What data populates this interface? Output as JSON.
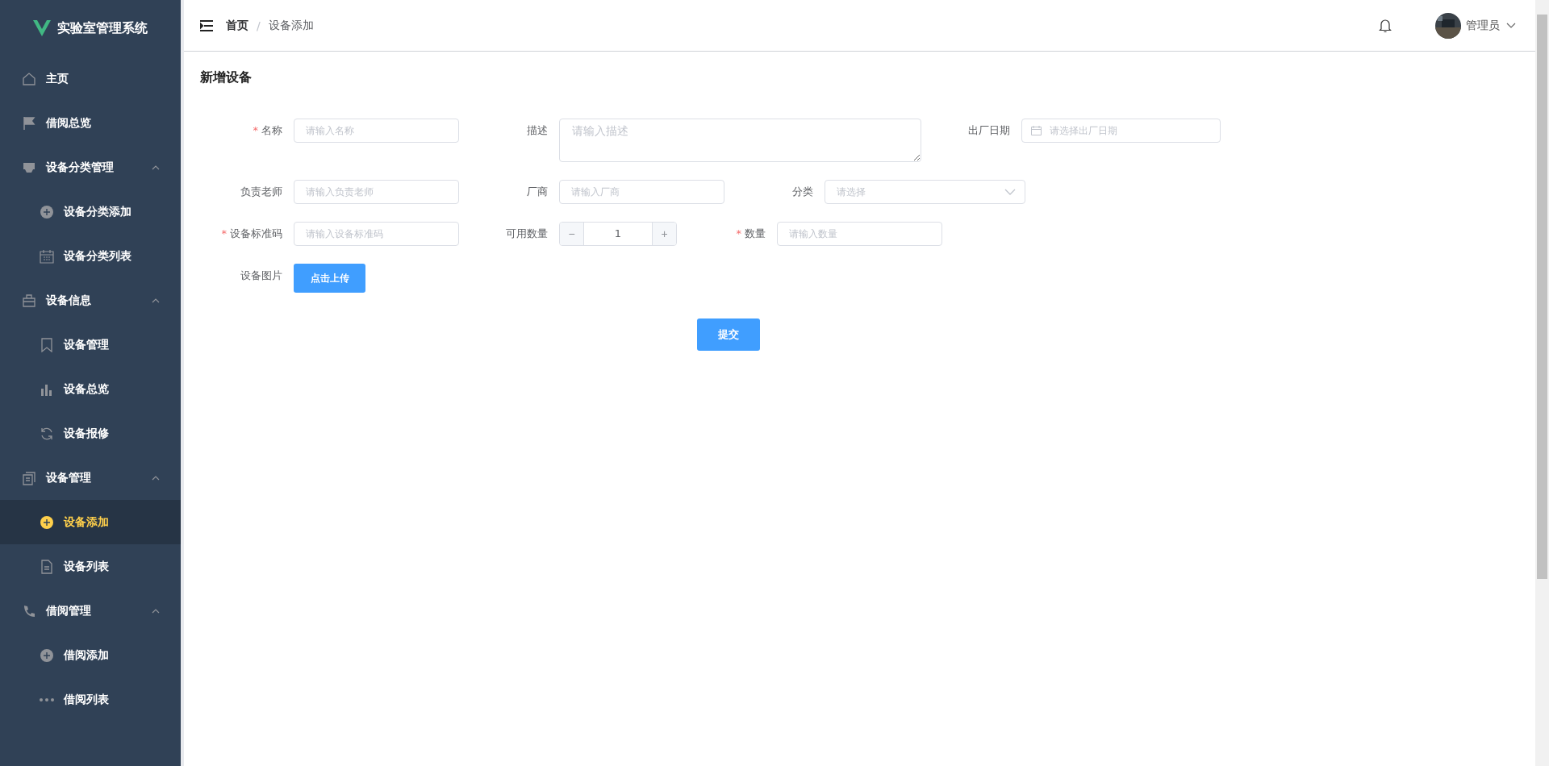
{
  "sidebar": {
    "title": "实验室管理系统",
    "items": [
      {
        "label": "主页",
        "selected": false
      },
      {
        "label": "借阅总览",
        "selected": false
      },
      {
        "label": "设备分类管理",
        "expanded": true,
        "children": [
          {
            "label": "设备分类添加",
            "selected": false
          },
          {
            "label": "设备分类列表",
            "selected": false
          }
        ]
      },
      {
        "label": "设备信息",
        "expanded": true,
        "children": [
          {
            "label": "设备管理",
            "selected": false
          },
          {
            "label": "设备总览",
            "selected": false
          },
          {
            "label": "设备报修",
            "selected": false
          }
        ]
      },
      {
        "label": "设备管理",
        "expanded": true,
        "children": [
          {
            "label": "设备添加",
            "selected": true
          },
          {
            "label": "设备列表",
            "selected": false
          }
        ]
      },
      {
        "label": "借阅管理",
        "expanded": true,
        "children": [
          {
            "label": "借阅添加",
            "selected": false
          },
          {
            "label": "借阅列表",
            "selected": false
          }
        ]
      }
    ]
  },
  "header": {
    "breadcrumb": [
      "首页",
      "设备添加"
    ],
    "separator": "/",
    "user": "管理员"
  },
  "form": {
    "title": "新增设备",
    "required_mark": "*",
    "rows": [
      [
        {
          "label": "名称",
          "required": true,
          "kind": "text",
          "placeholder": "请输入名称"
        },
        {
          "label": "描述",
          "required": false,
          "kind": "textarea",
          "placeholder": "请输入描述"
        },
        {
          "label": "出厂日期",
          "required": false,
          "kind": "date",
          "placeholder": "请选择出厂日期"
        }
      ],
      [
        {
          "label": "负责老师",
          "required": false,
          "kind": "text",
          "placeholder": "请输入负责老师"
        },
        {
          "label": "厂商",
          "required": false,
          "kind": "text",
          "placeholder": "请输入厂商"
        },
        {
          "label": "分类",
          "required": false,
          "kind": "select",
          "placeholder": "请选择"
        }
      ],
      [
        {
          "label": "设备标准码",
          "required": true,
          "kind": "text",
          "placeholder": "请输入设备标准码"
        },
        {
          "label": "可用数量",
          "required": false,
          "kind": "number",
          "value": "1",
          "minus": "−",
          "plus": "+"
        },
        {
          "label": "数量",
          "required": true,
          "kind": "text",
          "placeholder": "请输入数量"
        }
      ],
      [
        {
          "label": "设备图片",
          "required": false,
          "kind": "upload",
          "button": "点击上传"
        }
      ]
    ],
    "submit": "提交"
  }
}
